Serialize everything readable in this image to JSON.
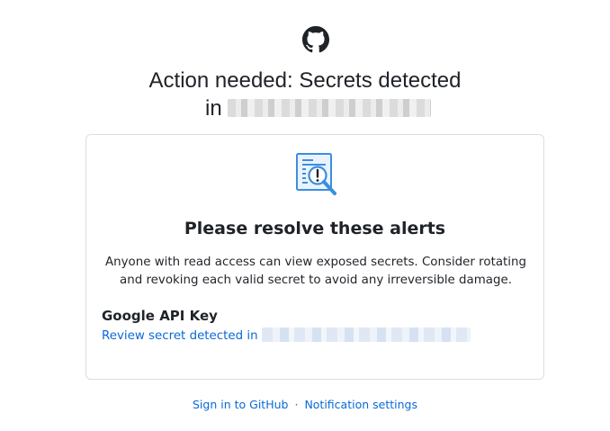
{
  "heading": {
    "line1": "Action needed: Secrets detected",
    "line2_prefix": "in"
  },
  "icons": {
    "logo": "github-octocat-icon",
    "alert": "document-magnifier-alert-icon"
  },
  "card": {
    "title": "Please resolve these alerts",
    "description": "Anyone with read access can view exposed secrets. Consider rotating and revoking each valid secret to avoid any irreversible damage.",
    "alerts": [
      {
        "type": "Google API Key",
        "link_text": "Review secret detected in"
      }
    ]
  },
  "footer": {
    "sign_in": "Sign in to GitHub",
    "separator": "·",
    "notification_settings": "Notification settings"
  },
  "colors": {
    "link": "#0969da",
    "text": "#1f2328",
    "border": "#d8dee4",
    "icon_blue": "#3b8ee0"
  }
}
